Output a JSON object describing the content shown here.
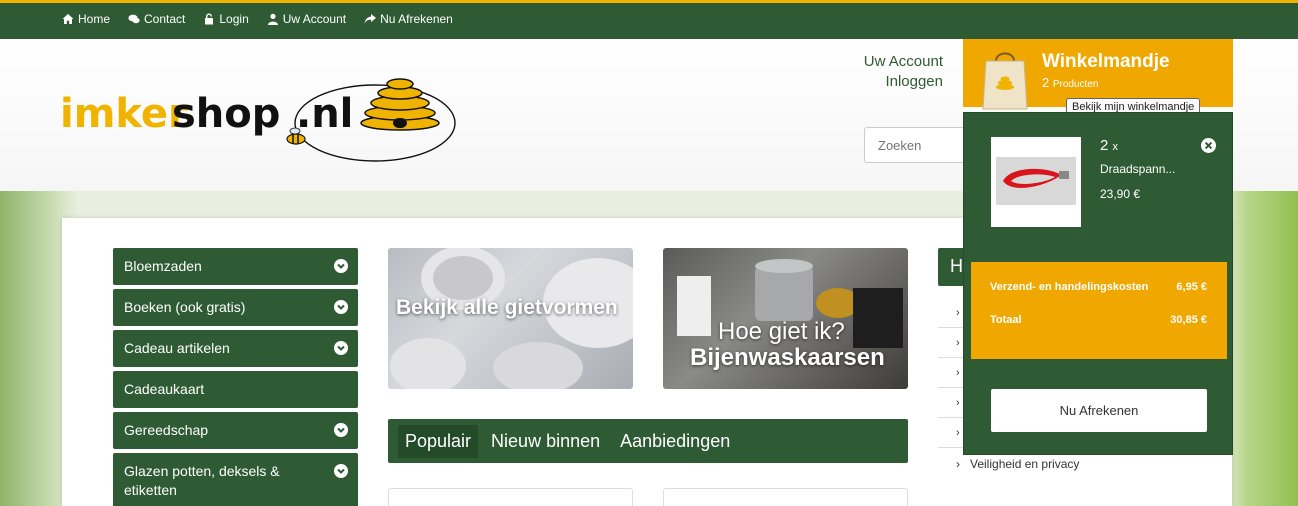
{
  "topnav": {
    "home": "Home",
    "contact": "Contact",
    "login": "Login",
    "account": "Uw Account",
    "checkout": "Nu Afrekenen"
  },
  "header": {
    "logo_text_1": "imker",
    "logo_text_2": "shop",
    "logo_text_3": ".nl",
    "account_link": "Uw Account",
    "login_link": "Inloggen",
    "search_placeholder": "Zoeken"
  },
  "categories": [
    {
      "label": "Bloemzaden",
      "expandable": true
    },
    {
      "label": "Boeken (ook gratis)",
      "expandable": true
    },
    {
      "label": "Cadeau artikelen",
      "expandable": true
    },
    {
      "label": "Cadeaukaart",
      "expandable": false
    },
    {
      "label": "Gereedschap",
      "expandable": true
    },
    {
      "label": "Glazen potten, deksels & etiketten",
      "expandable": true
    }
  ],
  "banners": {
    "b1": "Bekijk alle gietvormen",
    "b2_line1": "Hoe giet ik?",
    "b2_line2": "Bijenwaskaarsen"
  },
  "tabs": [
    "Populair",
    "Nieuw binnen",
    "Aanbiedingen"
  ],
  "info": {
    "head_initial": "H",
    "privacy": "Veiligheid en privacy"
  },
  "cart": {
    "title": "Winkelmandje",
    "count": "2",
    "count_unit": "Producten",
    "tooltip": "Bekijk mijn winkelmandje",
    "item": {
      "qty": "2",
      "qty_unit": "x",
      "name": "Draadspann...",
      "price": "23,90 €"
    },
    "shipping_label": "Verzend- en handelingskosten",
    "shipping_value": "6,95 €",
    "total_label": "Totaal",
    "total_value": "30,85 €",
    "checkout_label": "Nu Afrekenen"
  },
  "colors": {
    "green": "#2e5b34",
    "orange": "#f0a800",
    "logo_yellow": "#f0b400"
  }
}
